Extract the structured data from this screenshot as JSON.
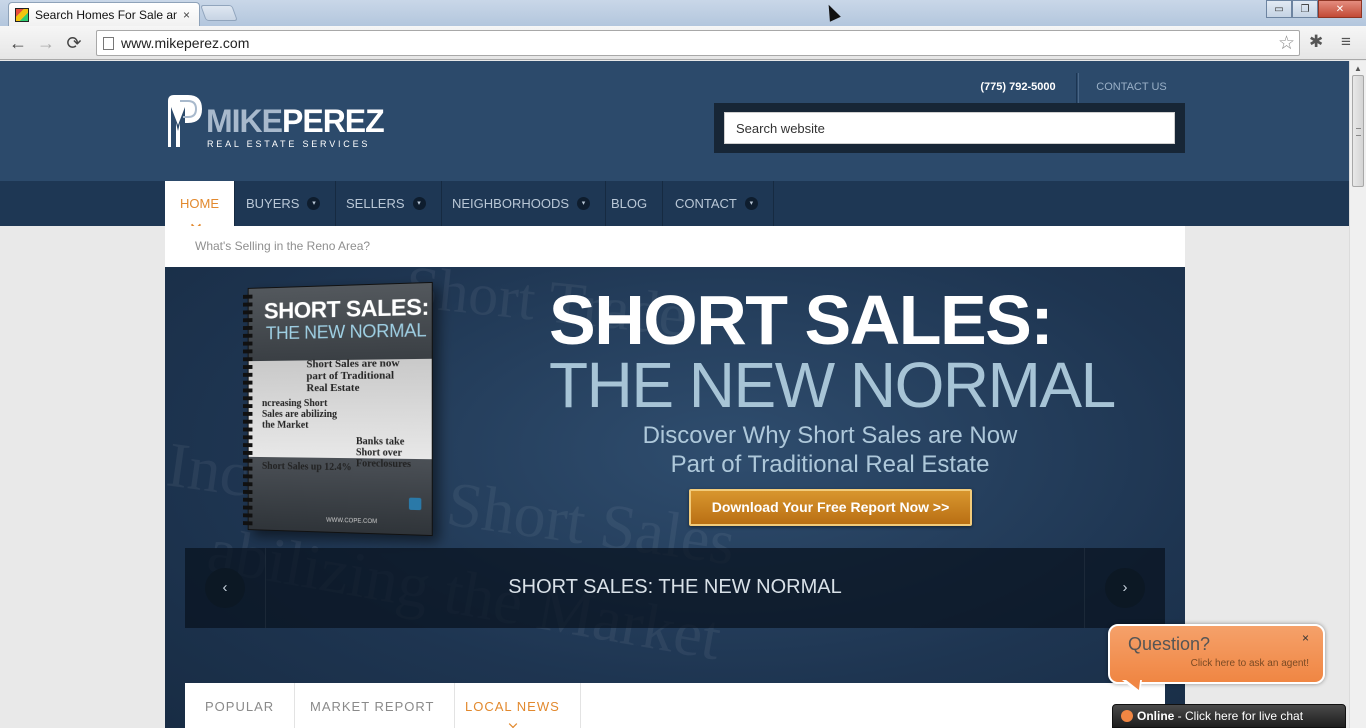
{
  "browser": {
    "tab_title": "Search Homes For Sale an",
    "tab_close": "×",
    "url": "www.mikeperez.com",
    "back_icon": "←",
    "forward_icon": "→",
    "reload_icon": "⟳",
    "star_icon": "☆",
    "wrench_icon": "≡",
    "bug_icon": "✱",
    "window": {
      "minimize": "▭",
      "maximize": "❐",
      "close": "✕"
    }
  },
  "header": {
    "logo": {
      "word_first": "MIKE",
      "word_second": "PEREZ",
      "tagline": "REAL ESTATE SERVICES"
    },
    "phone": "(775) 792-5000",
    "contact_link": "CONTACT US",
    "search_placeholder": "Search website"
  },
  "nav": {
    "items": [
      {
        "label": "HOME",
        "active": true,
        "dropdown": false
      },
      {
        "label": "BUYERS",
        "active": false,
        "dropdown": true
      },
      {
        "label": "SELLERS",
        "active": false,
        "dropdown": true
      },
      {
        "label": "NEIGHBORHOODS",
        "active": false,
        "dropdown": true
      },
      {
        "label": "BLOG",
        "active": false,
        "dropdown": false
      },
      {
        "label": "CONTACT",
        "active": false,
        "dropdown": true
      }
    ],
    "chevron_icon": "▾"
  },
  "subbar": {
    "text": "What's Selling in the Reno Area?"
  },
  "hero": {
    "booklet": {
      "title": "SHORT SALES:",
      "subtitle": "THE NEW NORMAL",
      "headline1": "Short Sales are now part of Traditional Real Estate",
      "headline2": "ncreasing Short Sales are abilizing the Market",
      "headline3": "Banks take Short over Foreclosures",
      "headline4": "Short Sales up 12.4%",
      "url": "WWW.COPE.COM"
    },
    "headline_line1": "SHORT SALES:",
    "headline_line2": "THE NEW NORMAL",
    "description_line1": "Discover Why Short Sales are Now",
    "description_line2": "Part of Traditional Real Estate",
    "cta": "Download Your Free Report Now >>",
    "slider": {
      "caption": "SHORT SALES: THE NEW NORMAL",
      "prev": "‹",
      "next": "›"
    }
  },
  "news_tabs": [
    {
      "label": "POPULAR",
      "active": false
    },
    {
      "label": "MARKET REPORT",
      "active": false
    },
    {
      "label": "LOCAL NEWS",
      "active": true
    }
  ],
  "chat": {
    "question": "Question?",
    "subtitle": "Click here to ask an agent!",
    "close": "×",
    "status": "Online",
    "bar_text": " - Click here for live chat"
  }
}
